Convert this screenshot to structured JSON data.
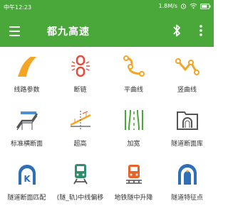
{
  "statusbar": {
    "time": "中午12:23",
    "speed": "1.8M/s"
  },
  "appbar": {
    "title": "都九高速"
  },
  "menu": [
    {
      "label": "线路参数",
      "icon": "route-road-icon"
    },
    {
      "label": "断链",
      "icon": "broken-chain-icon"
    },
    {
      "label": "平曲线",
      "icon": "horizontal-curve-icon"
    },
    {
      "label": "竖曲线",
      "icon": "vertical-curve-icon"
    },
    {
      "label": "标准横断面",
      "icon": "cross-section-icon"
    },
    {
      "label": "超高",
      "icon": "superelevation-icon"
    },
    {
      "label": "加宽",
      "icon": "widening-icon"
    },
    {
      "label": "隧道断面库",
      "icon": "tunnel-library-icon"
    },
    {
      "label": "隧道断面匹配",
      "icon": "tunnel-match-icon"
    },
    {
      "label": "(隧_轨)中线偏移",
      "icon": "metro-offset-icon"
    },
    {
      "label": "地铁隧中升降",
      "icon": "metro-lift-icon"
    },
    {
      "label": "隧道特征点",
      "icon": "tunnel-feature-point-icon"
    }
  ],
  "colors": {
    "primary": "#4aa83a",
    "orange": "#f5a524",
    "red": "#e84a3c",
    "gray": "#555555"
  }
}
